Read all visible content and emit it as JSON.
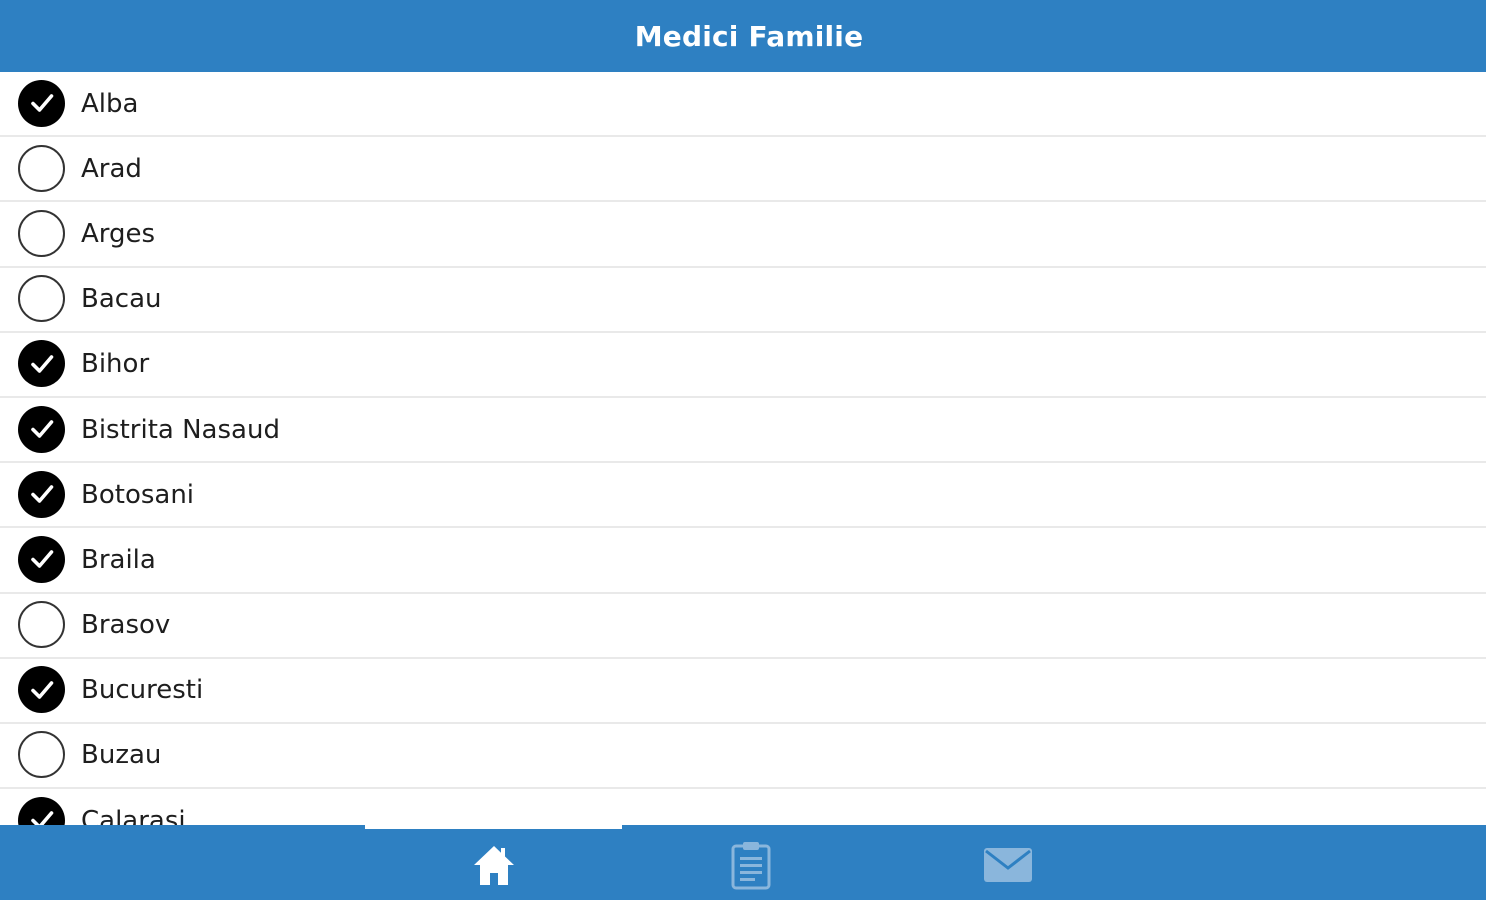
{
  "header": {
    "title": "Medici Familie"
  },
  "list": {
    "items": [
      {
        "label": "Alba",
        "checked": true
      },
      {
        "label": "Arad",
        "checked": false
      },
      {
        "label": "Arges",
        "checked": false
      },
      {
        "label": "Bacau",
        "checked": false
      },
      {
        "label": "Bihor",
        "checked": true
      },
      {
        "label": "Bistrita Nasaud",
        "checked": true
      },
      {
        "label": "Botosani",
        "checked": true
      },
      {
        "label": "Braila",
        "checked": true
      },
      {
        "label": "Brasov",
        "checked": false
      },
      {
        "label": "Bucuresti",
        "checked": true
      },
      {
        "label": "Buzau",
        "checked": false
      },
      {
        "label": "Calarasi",
        "checked": true
      }
    ]
  },
  "tabbar": {
    "active_tab": "home",
    "tabs": [
      {
        "id": "home",
        "icon": "home-icon"
      },
      {
        "id": "list",
        "icon": "clipboard-icon"
      },
      {
        "id": "mail",
        "icon": "mail-icon"
      }
    ]
  },
  "colors": {
    "accent": "#2e80c2",
    "active_icon": "#ffffff",
    "inactive_icon": "#8ab6dc",
    "checked_fill": "#000000",
    "divider": "#e9e9e9"
  }
}
